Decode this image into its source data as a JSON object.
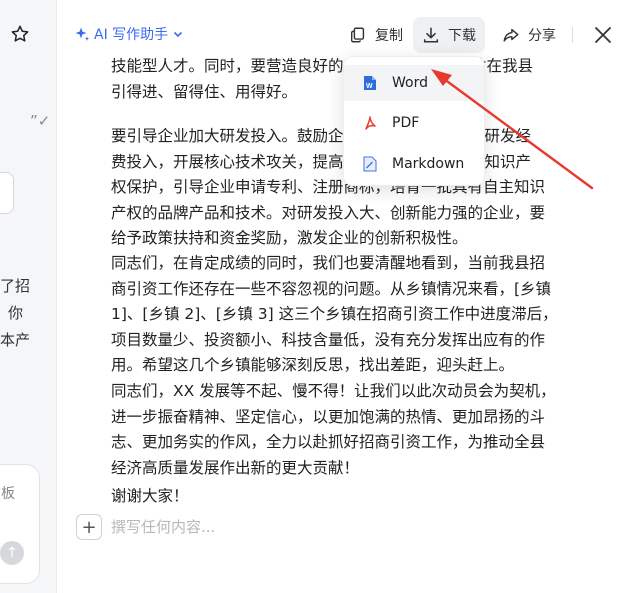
{
  "left_panel": {
    "fragments": [
      "”✓",
      "了招",
      "你",
      "本产",
      "板"
    ]
  },
  "toolbar": {
    "ai_label": "AI 写作助手",
    "copy_label": "复制",
    "download_label": "下载",
    "share_label": "分享"
  },
  "document": {
    "paragraphs": [
      [
        "技能型人才。同时，要营造良好的",
        "人才在我县",
        "引得进、留得住、用得好。"
      ],
      [
        "要引导企业加大研发投入。鼓励企",
        "加大研发经",
        "费投入，开展核心技术攻关，提高",
        "加强知识产",
        "权保护，引导企业申请专利、注册商标，培育一批具有自主知识",
        "产权的品牌产品和技术。对研发投入大、创新能力强的企业，要",
        "给予政策扶持和资金奖励，激发企业的创新积极性。"
      ],
      [
        "同志们，在肯定成绩的同时，我们也要清醒地看到，当前我县招",
        "商引资工作还存在一些不容忽视的问题。从乡镇情况来看，[乡镇",
        "1]、[乡镇 2]、[乡镇 3] 这三个乡镇在招商引资工作中进度滞后，",
        "项目数量少、投资额小、科技含量低，没有充分发挥出应有的作",
        "用。希望这几个乡镇能够深刻反思，找出差距，迎头赶上。"
      ],
      [
        "同志们，XX 发展等不起、慢不得！让我们以此次动员会为契机，",
        "进一步振奋精神、坚定信心，以更加饱满的热情、更加昂扬的斗",
        "志、更加务实的作风，全力以赴抓好招商引资工作，为推动全县",
        "经济高质量发展作出新的更大贡献！"
      ],
      [
        "谢谢大家！"
      ]
    ]
  },
  "compose": {
    "placeholder": "撰写任何内容..."
  },
  "download_menu": {
    "items": [
      "Word",
      "PDF",
      "Markdown"
    ]
  },
  "colors": {
    "accent": "#3b6af6",
    "arrow": "#e8392f",
    "word": "#2b6fe0",
    "pdf": "#e53b30",
    "markdown": "#4a6fe3"
  }
}
